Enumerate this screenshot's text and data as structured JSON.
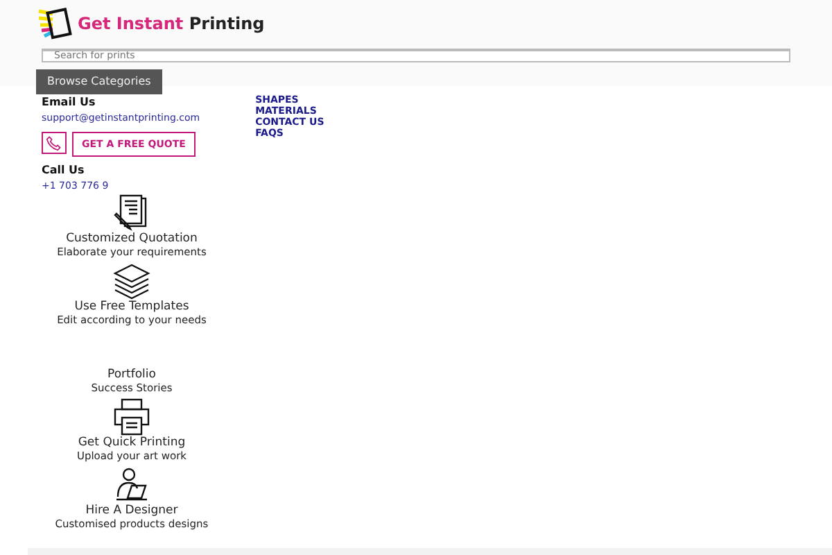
{
  "header": {
    "logo": {
      "accent": "Get Instant",
      "rest": "Printing"
    },
    "search": {
      "placeholder": "Search for prints"
    },
    "browse_button": "Browse Categories"
  },
  "nav": [
    "SHAPES",
    "MATERIALS",
    "CONTACT US",
    "FAQS"
  ],
  "contact": {
    "email_label": "Email Us",
    "email": "support@getinstantprinting.com",
    "quote_button": "GET A FREE QUOTE",
    "call_label": "Call Us",
    "phone": "+1 703 776 9"
  },
  "features": [
    {
      "kind": "quotation",
      "title": "Customized Quotation",
      "subtitle": "Elaborate your requirements"
    },
    {
      "kind": "templates",
      "title": "Use Free Templates",
      "subtitle": "Edit according to your needs"
    },
    {
      "kind": "none",
      "title": "Portfolio",
      "subtitle": "Success Stories"
    },
    {
      "kind": "printer",
      "title": "Get Quick Printing",
      "subtitle": "Upload your art work"
    },
    {
      "kind": "designer",
      "title": "Hire A Designer",
      "subtitle": "Customised products designs"
    }
  ]
}
